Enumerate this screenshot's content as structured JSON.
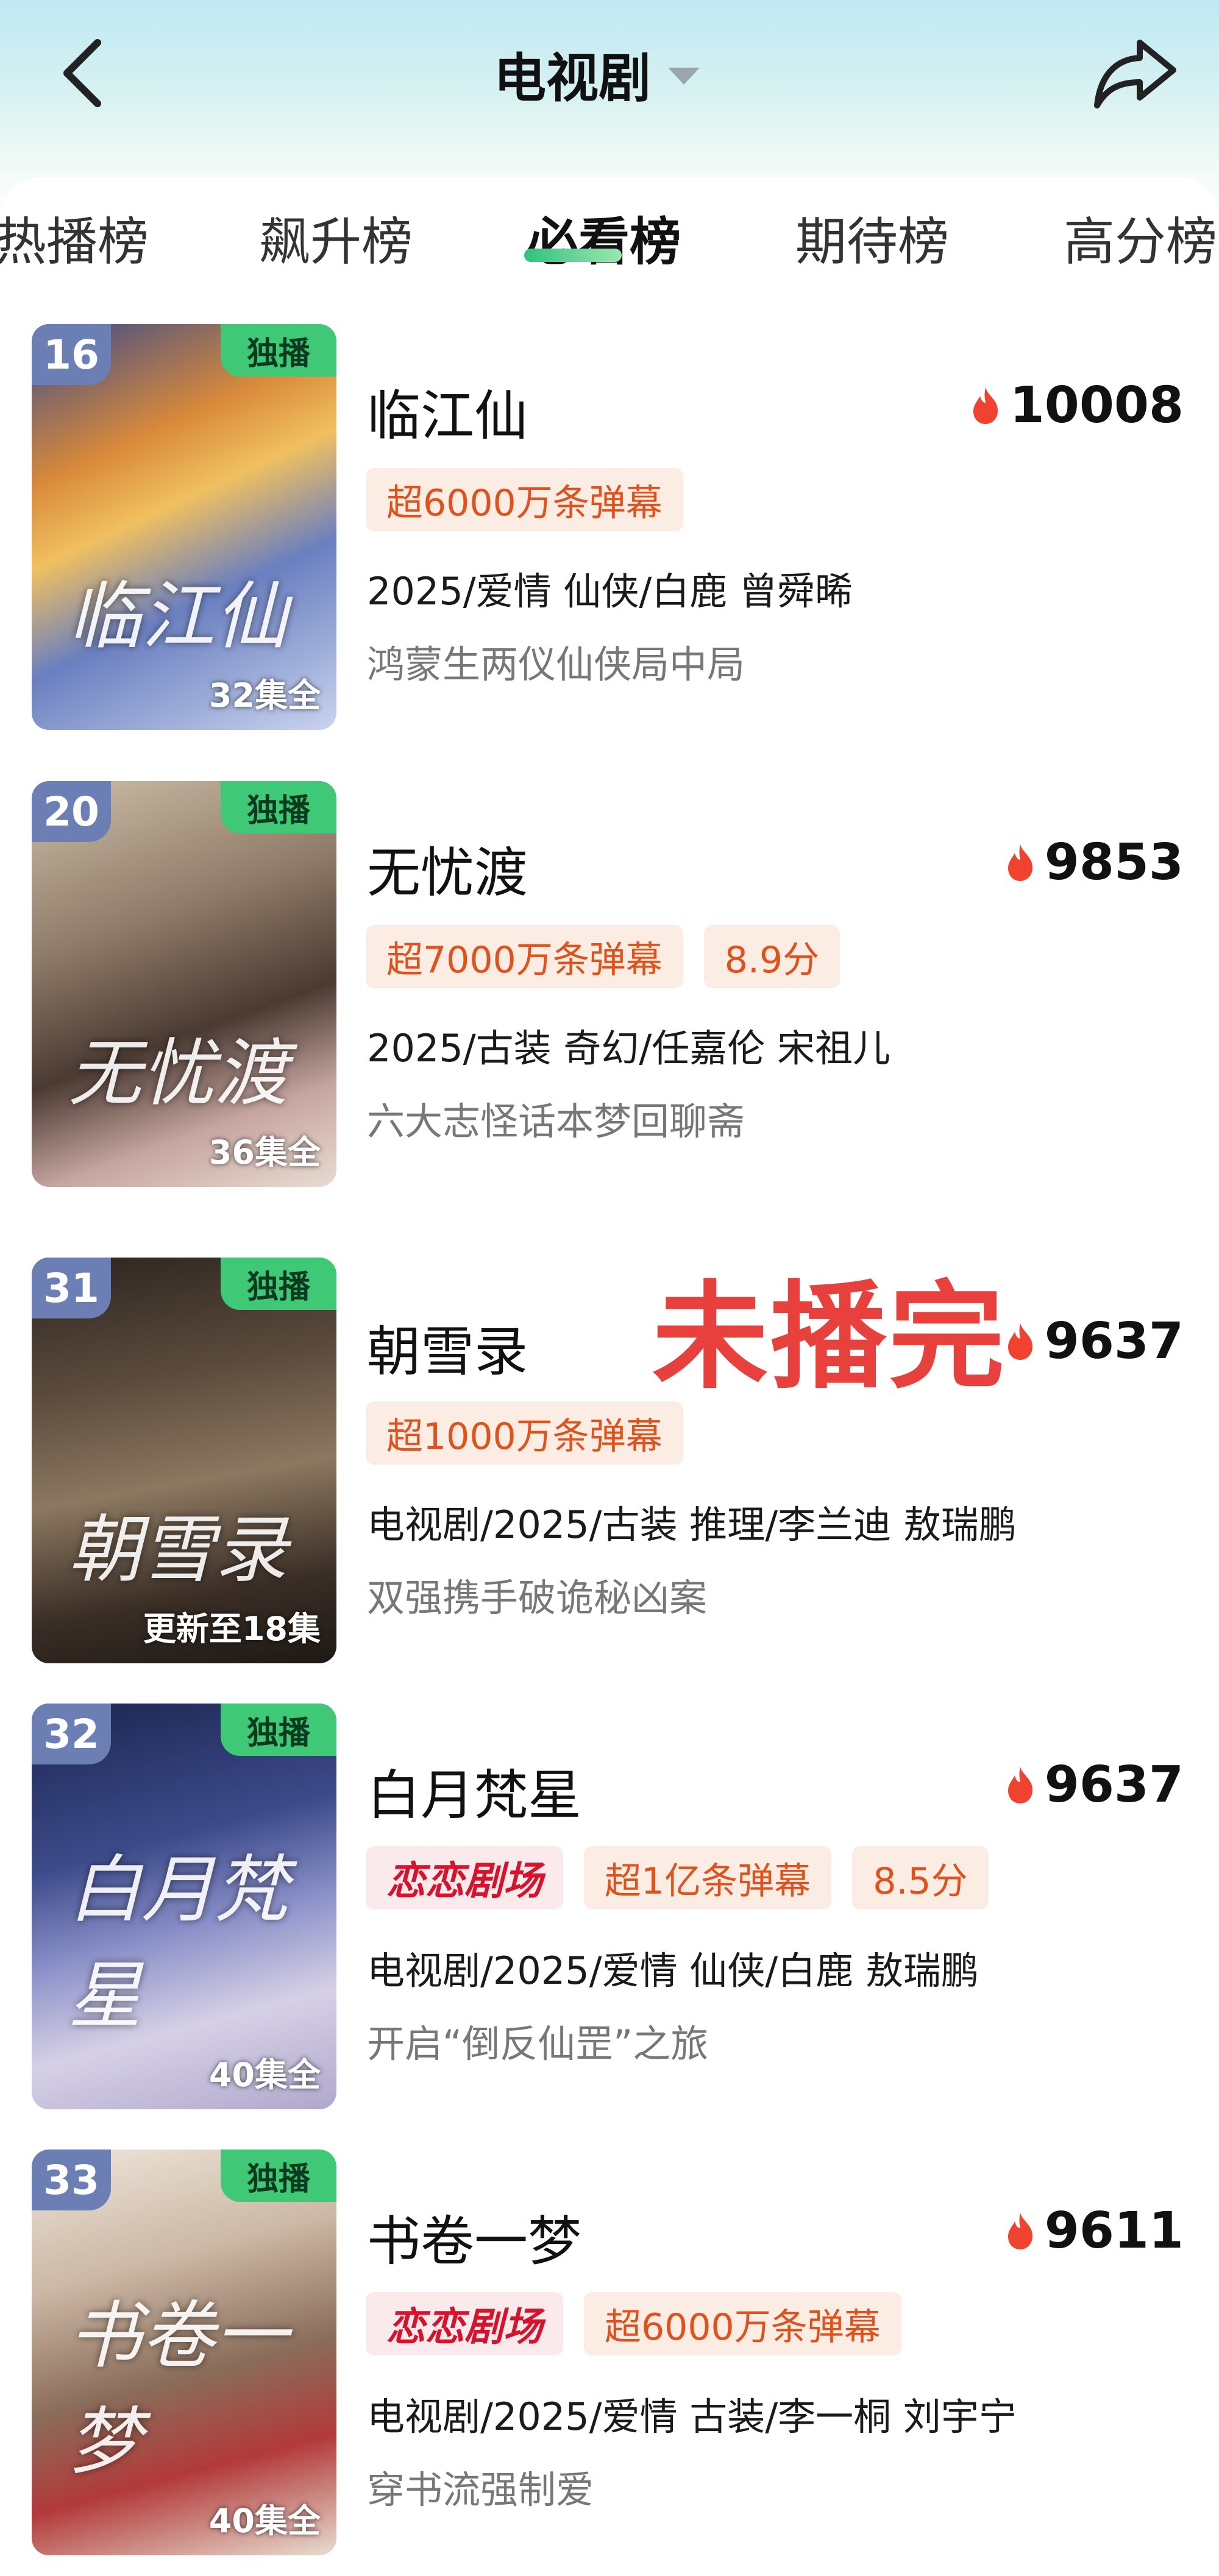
{
  "header": {
    "channel": "电视剧"
  },
  "tabs": [
    "热播榜",
    "飙升榜",
    "必看榜",
    "期待榜",
    "高分榜"
  ],
  "overlay_note": "未播完",
  "items": [
    {
      "rank": "16",
      "badge": "独播",
      "episodes": "32集全",
      "title": "临江仙",
      "heat": "10008",
      "tags": [
        "超6000万条弹幕"
      ],
      "meta": "2025/爱情 仙侠/白鹿 曾舜晞",
      "desc": "鸿蒙生两仪仙侠局中局",
      "poster_text": "临江仙"
    },
    {
      "rank": "20",
      "badge": "独播",
      "episodes": "36集全",
      "title": "无忧渡",
      "heat": "9853",
      "tags": [
        "超7000万条弹幕",
        "8.9分"
      ],
      "meta": "2025/古装 奇幻/任嘉伦 宋祖儿",
      "desc": "六大志怪话本梦回聊斋",
      "poster_text": "无忧渡"
    },
    {
      "rank": "31",
      "badge": "独播",
      "episodes": "更新至18集",
      "title": "朝雪录",
      "heat": "9637",
      "tags": [
        "超1000万条弹幕"
      ],
      "meta": "电视剧/2025/古装 推理/李兰迪 敖瑞鹏",
      "desc": "双强携手破诡秘凶案",
      "poster_text": "朝雪录"
    },
    {
      "rank": "32",
      "badge": "独播",
      "episodes": "40集全",
      "title": "白月梵星",
      "heat": "9637",
      "logo": "恋恋剧场",
      "tags": [
        "超1亿条弹幕",
        "8.5分"
      ],
      "meta": "电视剧/2025/爱情 仙侠/白鹿 敖瑞鹏",
      "desc": "开启“倒反仙罡”之旅",
      "poster_text": "白月梵星"
    },
    {
      "rank": "33",
      "badge": "独播",
      "episodes": "40集全",
      "title": "书卷一梦",
      "heat": "9611",
      "logo": "恋恋剧场",
      "tags": [
        "超6000万条弹幕"
      ],
      "meta": "电视剧/2025/爱情 古装/李一桐 刘宇宁",
      "desc": "穿书流强制爱",
      "poster_text": "书卷一梦"
    }
  ]
}
